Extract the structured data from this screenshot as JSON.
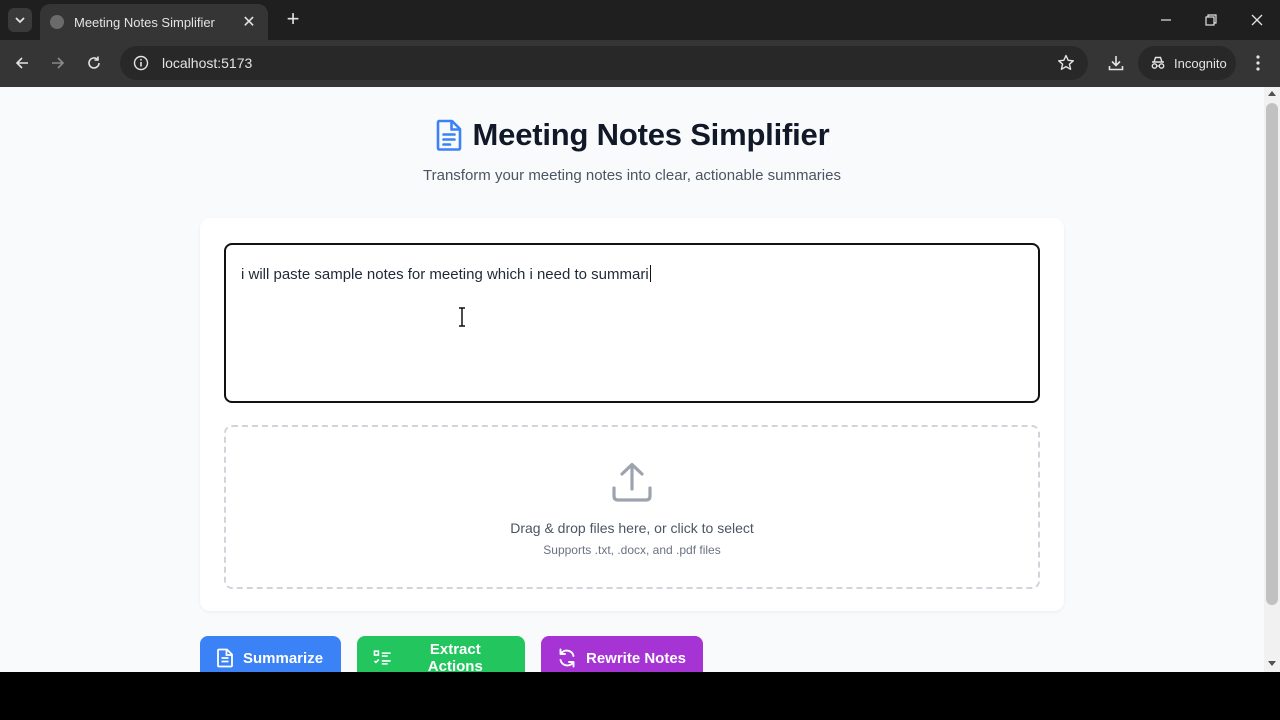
{
  "browser": {
    "tab_title": "Meeting Notes Simplifier",
    "url": "localhost:5173",
    "incognito_label": "Incognito"
  },
  "header": {
    "title": "Meeting Notes Simplifier",
    "subtitle": "Transform your meeting notes into clear, actionable summaries"
  },
  "editor": {
    "value": "i will paste sample notes for meeting which i need to summari"
  },
  "dropzone": {
    "main_text": "Drag & drop files here, or click to select",
    "sub_text": "Supports .txt, .docx, and .pdf files"
  },
  "actions": {
    "summarize": "Summarize",
    "extract": "Extract Actions",
    "rewrite": "Rewrite Notes"
  },
  "colors": {
    "summarize": "#3b82f6",
    "extract": "#22c55e",
    "rewrite": "#a633d4",
    "title_icon": "#3b82f6"
  },
  "icons": {
    "title": "document-icon",
    "upload": "upload-icon",
    "summarize": "document-icon",
    "extract": "checklist-icon",
    "rewrite": "refresh-icon"
  }
}
